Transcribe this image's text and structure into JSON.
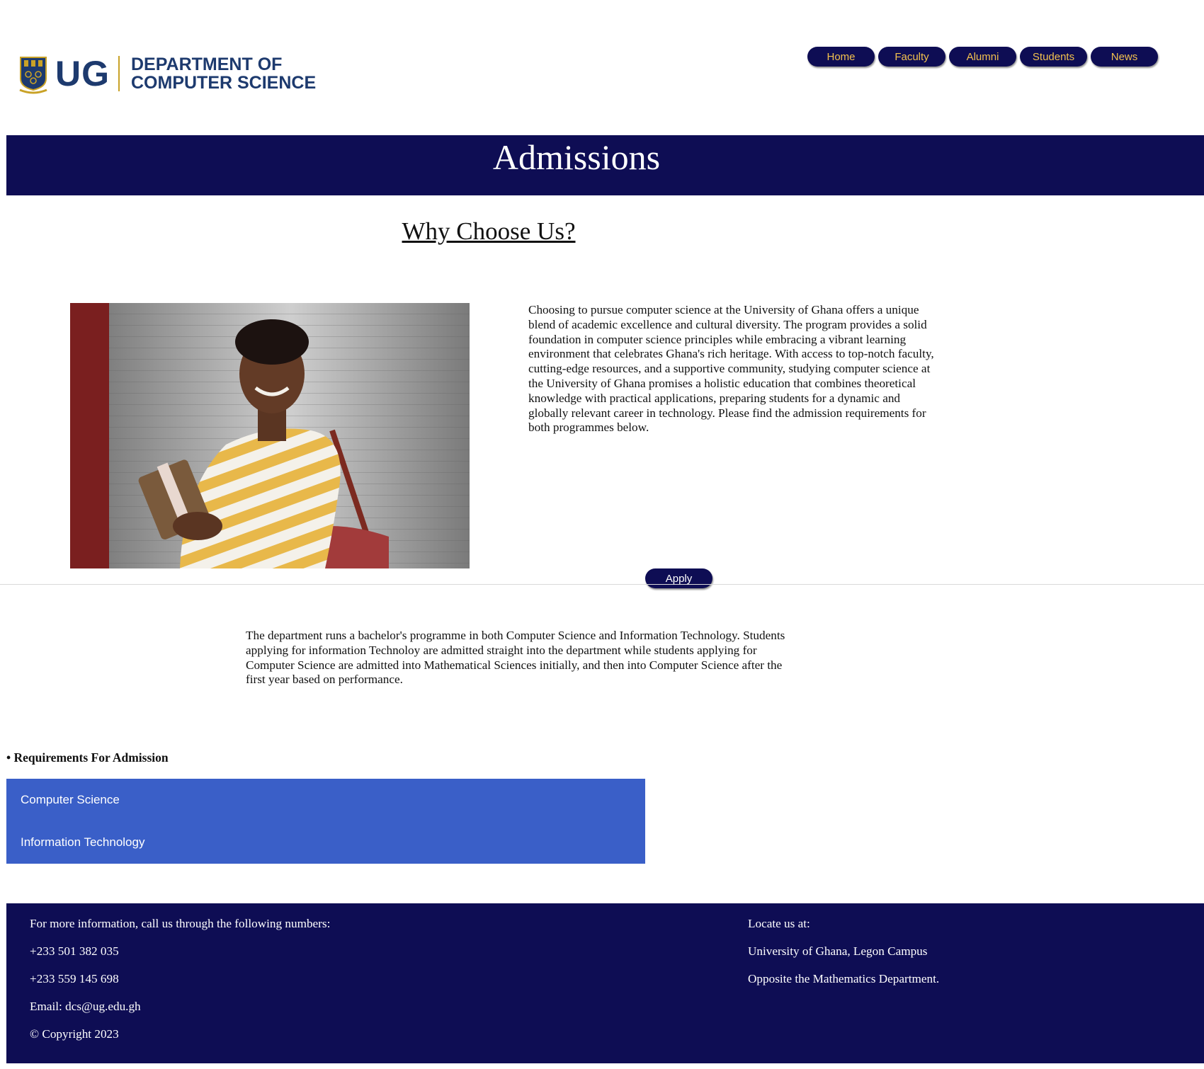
{
  "brand": {
    "logo_text": "UG",
    "dept_line1": "DEPARTMENT OF",
    "dept_line2": "COMPUTER SCIENCE",
    "crest_color": "#1d3a6e",
    "accent_gold": "#c9a227"
  },
  "nav": {
    "items": [
      {
        "label": "Home"
      },
      {
        "label": "Faculty"
      },
      {
        "label": "Alumni"
      },
      {
        "label": "Students"
      },
      {
        "label": "News"
      }
    ]
  },
  "hero": {
    "title": "Admissions"
  },
  "why": {
    "title": "Why Choose Us?",
    "body": "Choosing to pursue computer science at the University of Ghana offers a unique blend of academic excellence and cultural diversity. The program provides a solid foundation in computer science principles while embracing a vibrant learning environment that celebrates Ghana's rich heritage. With access to top-notch faculty, cutting-edge resources, and a supportive community, studying computer science at the University of Ghana promises a holistic education that combines theoretical knowledge with practical applications, preparing students for a dynamic and globally relevant career in technology. Please find the admission requirements for both programmes below."
  },
  "apply": {
    "label": "Apply"
  },
  "programs": {
    "text": "The department runs a bachelor's programme in both Computer Science and Information Technology. Students applying for information Technoloy are admitted straight into the department while students applying for Computer Science are admitted into Mathematical Sciences initially, and then into Computer Science after the first year based on performance."
  },
  "requirements": {
    "heading": "• Requirements For Admission",
    "items": [
      {
        "label": "Computer Science"
      },
      {
        "label": "Information Technology"
      }
    ]
  },
  "footer": {
    "left": [
      "For more information, call us through the following numbers:",
      "+233 501 382 035",
      "+233 559 145 698",
      "Email: dcs@ug.edu.gh",
      "© Copyright 2023"
    ],
    "right": [
      "Locate us at:",
      "University of Ghana, Legon Campus",
      "Opposite the Mathematics Department."
    ]
  },
  "colors": {
    "navy": "#0e0d54",
    "nav_text": "#f2c14e",
    "requirements_bg": "#3a5fc8"
  }
}
